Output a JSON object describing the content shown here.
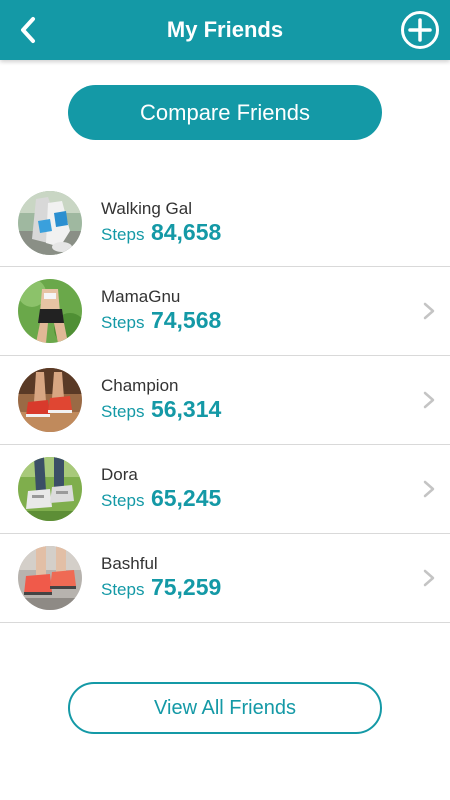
{
  "header": {
    "title": "My Friends",
    "back_icon": "chevron-left-icon",
    "add_icon": "plus-circle-icon"
  },
  "compare_button": {
    "label": "Compare Friends"
  },
  "friends": [
    {
      "name": "Walking Gal",
      "steps_label": "Steps",
      "steps": "84,658",
      "avatar": "walking-shoes-photo",
      "chevron": false
    },
    {
      "name": "MamaGnu",
      "steps_label": "Steps",
      "steps": "74,568",
      "avatar": "runner-photo",
      "chevron": true
    },
    {
      "name": "Champion",
      "steps_label": "Steps",
      "steps": "56,314",
      "avatar": "red-sneakers-photo",
      "chevron": true
    },
    {
      "name": "Dora",
      "steps_label": "Steps",
      "steps": "65,245",
      "avatar": "grass-sneakers-photo",
      "chevron": true
    },
    {
      "name": "Bashful",
      "steps_label": "Steps",
      "steps": "75,259",
      "avatar": "pavement-sneakers-photo",
      "chevron": true
    }
  ],
  "view_all_button": {
    "label": "View All Friends"
  },
  "colors": {
    "accent": "#1499a6",
    "text": "#333333",
    "divider": "#d9d9d9",
    "chevron": "#c4c4c4"
  }
}
